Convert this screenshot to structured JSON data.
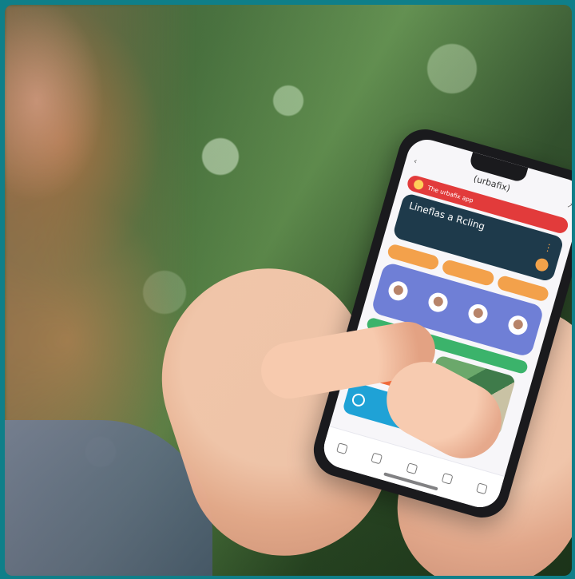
{
  "app": {
    "name": "(urbafix)",
    "banner_text": "The urbafix app",
    "hero_title": "Lineflas a Rcling",
    "pills": [
      "",
      "",
      ""
    ],
    "people": [
      "",
      "",
      "",
      ""
    ],
    "promo_label": "",
    "tabs": [
      "",
      "",
      "",
      "",
      ""
    ]
  },
  "colors": {
    "banner": "#e23b3b",
    "hero": "#1e3a4b",
    "accent": "#f2a24a",
    "people_panel": "#6f7fd6",
    "strip": "#3bb36b",
    "tile_orange": "#f06a3a",
    "tile_blue": "#1fa2d6"
  }
}
